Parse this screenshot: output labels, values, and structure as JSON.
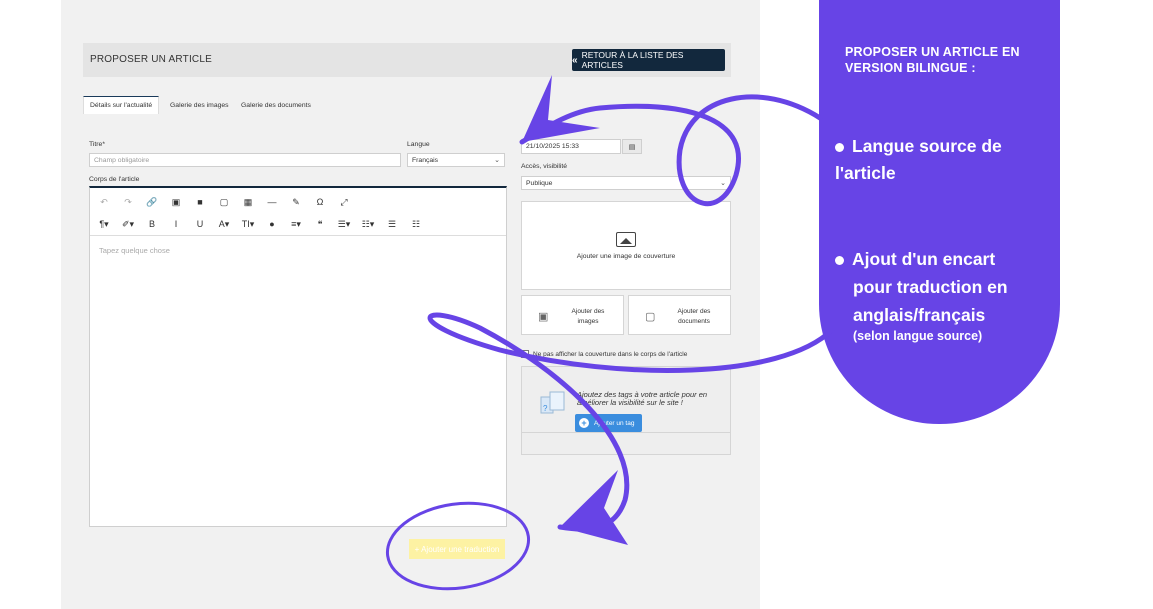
{
  "app": {
    "title": "PROPOSER UN ARTICLE",
    "back_button": "RETOUR À LA LISTE DES ARTICLES",
    "back_icon": "«",
    "tabs": [
      "Détails sur l'actualité",
      "Galerie des images",
      "Galerie des documents"
    ],
    "title_label": "Titre*",
    "title_placeholder": "Champ obligatoire",
    "language_label": "Langue",
    "language_value": "Français",
    "body_label": "Corps de l'article",
    "editor_placeholder": "Tapez quelque chose",
    "date_value": "21/10/2025 15:33",
    "access_label": "Accès, visibilité",
    "access_value": "Publique",
    "cover_label": "Ajouter une image de couverture",
    "add_images": "Ajouter des images",
    "add_documents": "Ajouter des documents",
    "hide_cover_checkbox": "Ne pas afficher la couverture dans le corps de l'article",
    "tags_prompt": "Ajoutez des tags à votre article pour en améliorer la visibilité sur le site !",
    "add_tag_button": "Ajouter un tag",
    "add_translation_button": "+ Ajouter une traduction",
    "toolbar_row1": [
      "↶",
      "↷",
      "🔗",
      "▣",
      "■",
      "▢",
      "▦",
      "—",
      "✎",
      "Ω",
      "⤢"
    ],
    "toolbar_row2": [
      "¶▾",
      "✐▾",
      "B",
      "I",
      "U",
      "A▾",
      "TI▾",
      "●",
      "≡▾",
      "❝",
      "☰▾",
      "☷▾",
      "☰",
      "☷"
    ]
  },
  "callout": {
    "title": "PROPOSER UN ARTICLE EN VERSION BILINGUE :",
    "bullet1": "Langue source de l'article",
    "bullet2_line1": "Ajout d'un encart",
    "bullet2_line2": "pour traduction en",
    "bullet2_line3": "anglais/français",
    "bullet2_note": "(selon langue source)"
  },
  "colors": {
    "accent_purple": "#6744e6",
    "navy": "#12283d",
    "tag_blue": "#3a8dde",
    "highlight_yellow": "#fdf2a3"
  }
}
